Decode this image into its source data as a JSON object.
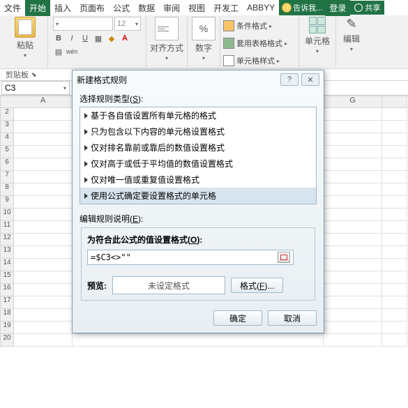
{
  "tabs": {
    "file": "文件",
    "home": "开始",
    "insert": "插入",
    "layout": "页面布",
    "formula": "公式",
    "data": "数据",
    "review": "审阅",
    "view": "视图",
    "dev": "开发工",
    "abbyy": "ABBYY",
    "tellme": "告诉我...",
    "login": "登录",
    "share": "共享"
  },
  "ribbon": {
    "paste": "粘贴",
    "clipboard": "剪贴板",
    "font_size": "12",
    "align": "对齐方式",
    "number": "数字",
    "percent": "%",
    "cond": "条件格式",
    "tablefmt": "套用表格格式",
    "cellstyle": "单元格样式",
    "cells": "单元格",
    "edit": "编辑",
    "btns": {
      "b": "B",
      "i": "I",
      "u": "U",
      "wen": "wén"
    }
  },
  "namebox": "C3",
  "cols": [
    "A",
    "G"
  ],
  "rows": [
    "2",
    "3",
    "4",
    "5",
    "6",
    "7",
    "8",
    "9",
    "10",
    "11",
    "12",
    "13",
    "14",
    "15",
    "16",
    "17",
    "18",
    "19",
    "20"
  ],
  "dlg": {
    "title": "新建格式规则",
    "select_label": "选择规则类型",
    "select_u": "S",
    "rules": [
      "基于各自值设置所有单元格的格式",
      "只为包含以下内容的单元格设置格式",
      "仅对排名靠前或靠后的数值设置格式",
      "仅对高于或低于平均值的数值设置格式",
      "仅对唯一值或重复值设置格式",
      "使用公式确定要设置格式的单元格"
    ],
    "edit_label": "编辑规则说明",
    "edit_u": "E",
    "cond_label": "为符合此公式的值设置格式",
    "cond_u": "O",
    "formula": "=$C3<>\"\"",
    "preview_lbl": "预览:",
    "preview_txt": "未设定格式",
    "format_btn": "格式",
    "format_u": "F",
    "ok": "确定",
    "cancel": "取消",
    "help": "?",
    "close": "✕"
  }
}
